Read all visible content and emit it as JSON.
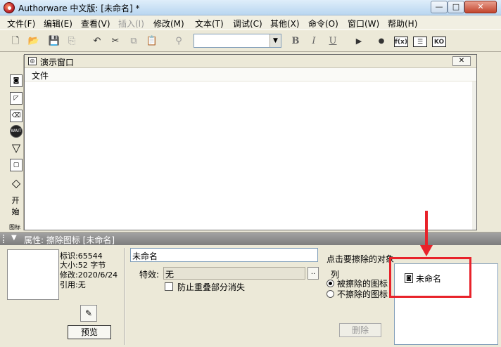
{
  "window": {
    "title": "Authorware 中文版: [未命名] *",
    "min_label": "—",
    "max_label": "□",
    "close_label": "✕"
  },
  "menu": [
    "文件(F)",
    "编辑(E)",
    "查看(V)",
    "插入(I)",
    "修改(M)",
    "文本(T)",
    "调试(C)",
    "其他(X)",
    "命令(O)",
    "窗口(W)",
    "帮助(H)"
  ],
  "toolbar": {
    "combo_value": "",
    "combo_arrow": "▼",
    "bold": "B",
    "italic": "I",
    "underline": "U",
    "run": "▶",
    "control_panel": "●",
    "functions": "f(x)",
    "variables": "☰",
    "knowledge_objects": "KO"
  },
  "palette_icons": [
    "display-icon",
    "motion-icon",
    "erase-icon",
    "wait-icon",
    "navigate-icon",
    "framework-icon",
    "decision-icon",
    "interaction-icon"
  ],
  "palette_labels": {
    "wait": "WAIT",
    "start": "开始",
    "flag": "图标"
  },
  "presentation": {
    "title": "演示窗口",
    "menu_file": "文件",
    "close_label": "✕"
  },
  "properties": {
    "header": "属性: 擦除图标 [未命名]",
    "toggle": "▼",
    "info": {
      "id": "标识:65544",
      "size": "大小:52 字节",
      "modified": "修改:2020/6/24",
      "refs": "引用:无"
    },
    "preview_button": "预览",
    "name_value": "未命名",
    "effect_label": "特效:",
    "effect_value": "无",
    "effect_button": "..",
    "prevent_label": "防止重叠部分消失",
    "prevent_checked": false,
    "click_hint": "点击要擦除的对象",
    "list_label": "列",
    "radio_erased": "被擦除的图标",
    "radio_not_erased": "不擦除的图标",
    "radio_selected": "erased",
    "delete_button": "删除",
    "erase_list": [
      "未命名"
    ]
  },
  "colors": {
    "annotation": "#e8222a",
    "header_bg": "#8c8c8c",
    "window_bg": "#ece9d8"
  }
}
